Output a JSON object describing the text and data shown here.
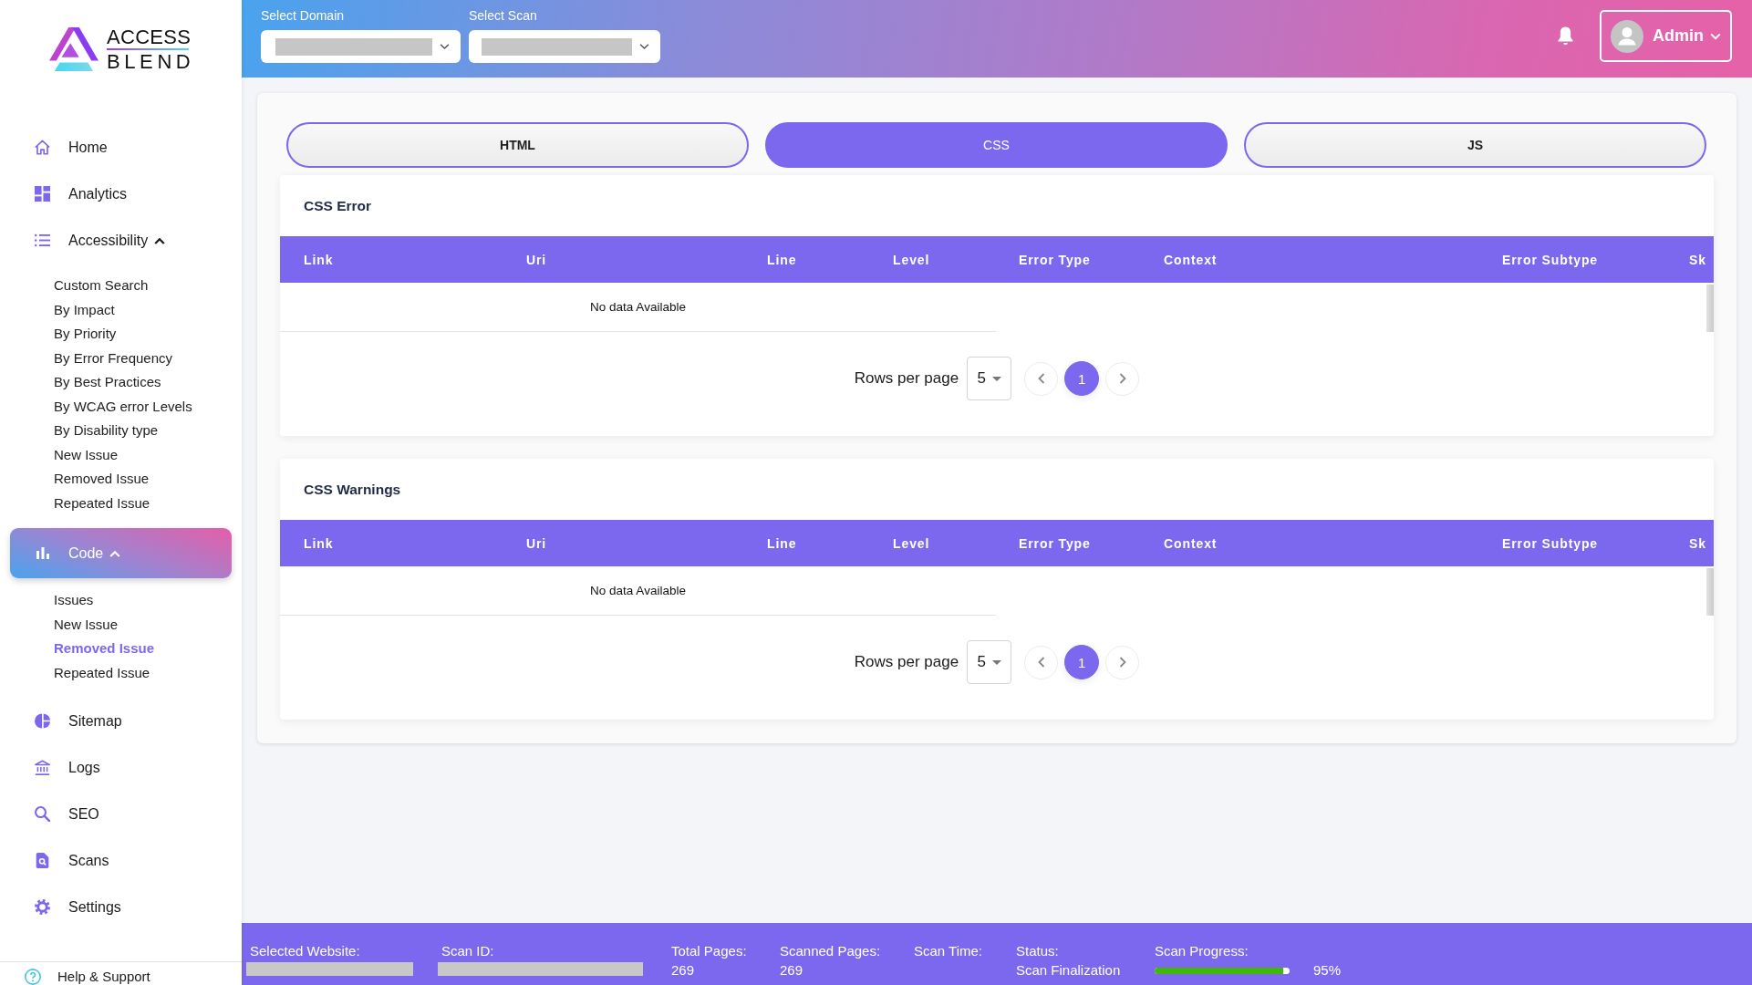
{
  "sidebar": {
    "logo": {
      "line_1": "ACCESS",
      "line_2": "BLEND"
    },
    "items": [
      {
        "label": "Home",
        "selected": false
      },
      {
        "label": "Analytics",
        "selected": false
      },
      {
        "label": "Accessibility",
        "selected": false,
        "expanded": true,
        "children": [
          {
            "label": "Custom Search",
            "selected": false
          },
          {
            "label": "By Impact",
            "selected": false
          },
          {
            "label": "By Priority",
            "selected": false
          },
          {
            "label": "By Error Frequency",
            "selected": false
          },
          {
            "label": "By Best Practices",
            "selected": false
          },
          {
            "label": "By WCAG error Levels",
            "selected": false
          },
          {
            "label": "By Disability type",
            "selected": false
          },
          {
            "label": "New Issue",
            "selected": false
          },
          {
            "label": "Removed Issue",
            "selected": false
          },
          {
            "label": "Repeated Issue",
            "selected": false
          }
        ]
      },
      {
        "label": "Code",
        "selected": true,
        "expanded": true,
        "children": [
          {
            "label": "Issues",
            "selected": false
          },
          {
            "label": "New Issue",
            "selected": false
          },
          {
            "label": "Removed Issue",
            "selected": true
          },
          {
            "label": "Repeated Issue",
            "selected": false
          }
        ]
      },
      {
        "label": "Sitemap",
        "selected": false
      },
      {
        "label": "Logs",
        "selected": false
      },
      {
        "label": "SEO",
        "selected": false
      },
      {
        "label": "Scans",
        "selected": false
      },
      {
        "label": "Settings",
        "selected": false
      }
    ],
    "help": {
      "label": "Help & Support"
    }
  },
  "topbar": {
    "selects": [
      {
        "label": "Select Domain"
      },
      {
        "label": "Select Scan"
      }
    ],
    "user": {
      "name": "Admin"
    }
  },
  "tabs": [
    {
      "label": "HTML",
      "selected": false
    },
    {
      "label": "CSS",
      "selected": true
    },
    {
      "label": "JS",
      "selected": false
    }
  ],
  "panels": [
    {
      "title": "CSS Error",
      "columns": [
        "Link",
        "Uri",
        "Line",
        "Level",
        "Error Type",
        "Context",
        "Error Subtype",
        "Sk"
      ],
      "empty_message": "No data Available",
      "pagination": {
        "label": "Rows per page",
        "rows_per_page": "5",
        "pages": [
          {
            "label": "1",
            "selected": true
          }
        ]
      }
    },
    {
      "title": "CSS Warnings",
      "columns": [
        "Link",
        "Uri",
        "Line",
        "Level",
        "Error Type",
        "Context",
        "Error Subtype",
        "Sk"
      ],
      "empty_message": "No data Available",
      "pagination": {
        "label": "Rows per page",
        "rows_per_page": "5",
        "pages": [
          {
            "label": "1",
            "selected": true
          }
        ]
      }
    }
  ],
  "status_bar": {
    "items": [
      {
        "label": "Selected Website:",
        "kind": "redacted"
      },
      {
        "label": "Scan ID:",
        "kind": "redacted"
      },
      {
        "label": "Total Pages:",
        "kind": "text",
        "value": "269"
      },
      {
        "label": "Scanned Pages:",
        "kind": "text",
        "value": "269"
      },
      {
        "label": "Scan Time:",
        "kind": "text"
      },
      {
        "label": "Status:",
        "kind": "text",
        "value": "Scan Finalization"
      },
      {
        "label": "Scan Progress:",
        "kind": "progress",
        "level": 0.95,
        "reading": "95%"
      }
    ]
  }
}
